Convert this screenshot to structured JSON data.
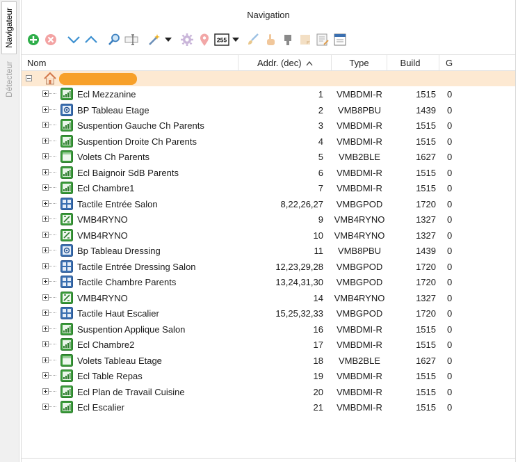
{
  "vertical_tabs": {
    "active": "Navigateur",
    "inactive": "Détecteur"
  },
  "panel": {
    "title": "Navigation"
  },
  "toolbar": {
    "icons": [
      "add-icon",
      "remove-icon",
      "chevron-down-icon",
      "chevron-up-icon",
      "search-icon",
      "rename-icon",
      "wand-icon",
      "dropdown-arrow-icon",
      "gear-icon",
      "location-pin-icon",
      "address-255-icon",
      "dropdown-arrow-icon",
      "brush-icon",
      "hand-icon",
      "stamp-icon",
      "note-icon",
      "document-edit-icon",
      "window-icon"
    ],
    "address_badge": "255"
  },
  "columns": {
    "nom": "Nom",
    "addr": "Addr. (dec)",
    "type": "Type",
    "build": "Build",
    "g": "G"
  },
  "sort": {
    "column": "addr",
    "direction": "ascending",
    "indicator": "^"
  },
  "root": {
    "label": "",
    "icon": "house-icon",
    "expanded": true
  },
  "colors": {
    "root_highlight": "#fde9d2",
    "redaction": "#f7a02a",
    "relay_green": "#3a9b3a",
    "button_blue": "#3a6fb0"
  },
  "modules": [
    {
      "name": "Ecl Mezzanine",
      "addr": "1",
      "type": "VMBDMI-R",
      "build": "1515",
      "g": "0",
      "icon": "dimmer-icon"
    },
    {
      "name": "BP Tableau Etage",
      "addr": "2",
      "type": "VMB8PBU",
      "build": "1439",
      "g": "0",
      "icon": "pushbutton-icon"
    },
    {
      "name": "Suspention Gauche Ch Parents",
      "addr": "3",
      "type": "VMBDMI-R",
      "build": "1515",
      "g": "0",
      "icon": "dimmer-icon"
    },
    {
      "name": "Suspention Droite Ch Parents",
      "addr": "4",
      "type": "VMBDMI-R",
      "build": "1515",
      "g": "0",
      "icon": "dimmer-icon"
    },
    {
      "name": "Volets Ch Parents",
      "addr": "5",
      "type": "VMB2BLE",
      "build": "1627",
      "g": "0",
      "icon": "blind-icon"
    },
    {
      "name": "Ecl Baignoir SdB Parents",
      "addr": "6",
      "type": "VMBDMI-R",
      "build": "1515",
      "g": "0",
      "icon": "dimmer-icon"
    },
    {
      "name": "Ecl Chambre1",
      "addr": "7",
      "type": "VMBDMI-R",
      "build": "1515",
      "g": "0",
      "icon": "dimmer-icon"
    },
    {
      "name": "Tactile Entrée Salon",
      "addr": "8,22,26,27",
      "type": "VMBGPOD",
      "build": "1720",
      "g": "0",
      "icon": "touchpanel-icon"
    },
    {
      "name": "VMB4RYNO",
      "addr": "9",
      "type": "VMB4RYNO",
      "build": "1327",
      "g": "0",
      "icon": "relay-icon"
    },
    {
      "name": "VMB4RYNO",
      "addr": "10",
      "type": "VMB4RYNO",
      "build": "1327",
      "g": "0",
      "icon": "relay-icon"
    },
    {
      "name": "Bp Tableau Dressing",
      "addr": "11",
      "type": "VMB8PBU",
      "build": "1439",
      "g": "0",
      "icon": "pushbutton-icon"
    },
    {
      "name": "Tactile Entrée Dressing Salon",
      "addr": "12,23,29,28",
      "type": "VMBGPOD",
      "build": "1720",
      "g": "0",
      "icon": "touchpanel-icon"
    },
    {
      "name": "Tactile Chambre Parents",
      "addr": "13,24,31,30",
      "type": "VMBGPOD",
      "build": "1720",
      "g": "0",
      "icon": "touchpanel-icon"
    },
    {
      "name": "VMB4RYNO",
      "addr": "14",
      "type": "VMB4RYNO",
      "build": "1327",
      "g": "0",
      "icon": "relay-icon"
    },
    {
      "name": "Tactile Haut Escalier",
      "addr": "15,25,32,33",
      "type": "VMBGPOD",
      "build": "1720",
      "g": "0",
      "icon": "touchpanel-icon"
    },
    {
      "name": "Suspention Applique Salon",
      "addr": "16",
      "type": "VMBDMI-R",
      "build": "1515",
      "g": "0",
      "icon": "dimmer-icon"
    },
    {
      "name": "Ecl Chambre2",
      "addr": "17",
      "type": "VMBDMI-R",
      "build": "1515",
      "g": "0",
      "icon": "dimmer-icon"
    },
    {
      "name": "Volets Tableau Etage",
      "addr": "18",
      "type": "VMB2BLE",
      "build": "1627",
      "g": "0",
      "icon": "blind-icon"
    },
    {
      "name": "Ecl Table Repas",
      "addr": "19",
      "type": "VMBDMI-R",
      "build": "1515",
      "g": "0",
      "icon": "dimmer-icon"
    },
    {
      "name": "Ecl Plan de Travail Cuisine",
      "addr": "20",
      "type": "VMBDMI-R",
      "build": "1515",
      "g": "0",
      "icon": "dimmer-icon"
    },
    {
      "name": "Ecl Escalier",
      "addr": "21",
      "type": "VMBDMI-R",
      "build": "1515",
      "g": "0",
      "icon": "dimmer-icon"
    }
  ]
}
